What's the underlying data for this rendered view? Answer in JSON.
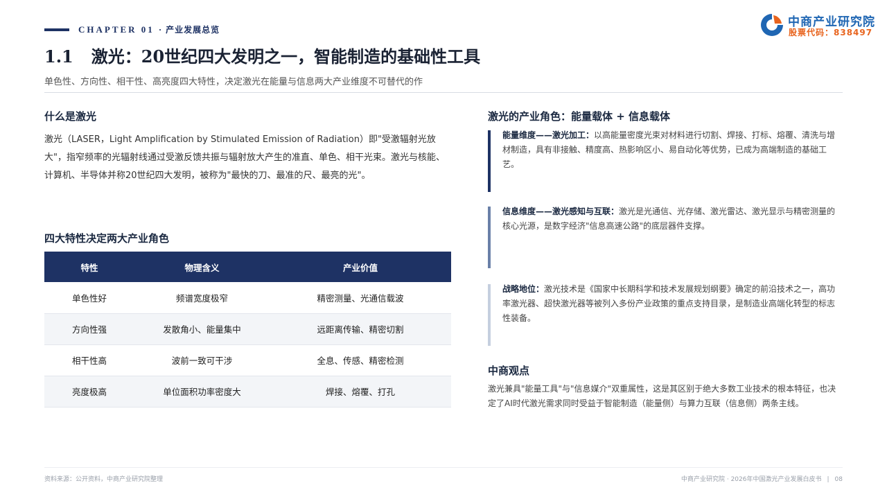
{
  "header": {
    "chapter": "CHAPTER 01",
    "separator": "·",
    "chapter_title": "产业发展总览",
    "logo_name": "中商产业研究院",
    "logo_code": "股票代码：838497",
    "logo_colors": {
      "blue": "#1f66b3",
      "orange": "#e8641e"
    }
  },
  "title": {
    "number": "1.1",
    "text": "激光：20世纪四大发明之一，智能制造的基础性工具"
  },
  "subtitle": "单色性、方向性、相干性、高亮度四大特性，决定激光在能量与信息两大产业维度不可替代的作",
  "left": {
    "what_heading": "什么是激光",
    "what_body": "激光（LASER，Light Amplification by Stimulated Emission of Radiation）即\"受激辐射光放大\"，指窄频率的光辐射线通过受激反馈共振与辐射放大产生的准直、单色、相干光束。激光与核能、计算机、半导体并称20世纪四大发明，被称为\"最快的刀、最准的尺、最亮的光\"。",
    "table_heading": "四大特性决定两大产业角色",
    "table": {
      "headers": [
        "特性",
        "物理含义",
        "产业价值"
      ],
      "rows": [
        [
          "单色性好",
          "频谱宽度极窄",
          "精密测量、光通信载波"
        ],
        [
          "方向性强",
          "发散角小、能量集中",
          "远距离传输、精密切割"
        ],
        [
          "相干性高",
          "波前一致可干涉",
          "全息、传感、精密检测"
        ],
        [
          "亮度极高",
          "单位面积功率密度大",
          "焊接、熔覆、打孔"
        ]
      ]
    }
  },
  "right": {
    "heading": "激光的产业角色：能量载体 + 信息载体",
    "cards": [
      {
        "label": "能量维度——激光加工：",
        "text": "以高能量密度光束对材料进行切割、焊接、打标、熔覆、清洗与增材制造，具有非接触、精度高、热影响区小、易自动化等优势，已成为高端制造的基础工艺。",
        "color": "#1e3264"
      },
      {
        "label": "信息维度——激光感知与互联：",
        "text": "激光是光通信、光存储、激光雷达、激光显示与精密测量的核心光源，是数字经济\"信息高速公路\"的底层器件支撑。",
        "color": "#6a80a8"
      },
      {
        "label": "战略地位：",
        "text": "激光技术是《国家中长期科学和技术发展规划纲要》确定的前沿技术之一，高功率激光器、超快激光器等被列入多份产业政策的重点支持目录，是制造业高端化转型的标志性装备。",
        "color": "#c5cfdf"
      }
    ],
    "opinion_title": "中商观点",
    "opinion_text": "激光兼具\"能量工具\"与\"信息媒介\"双重属性，这是其区别于绝大多数工业技术的根本特征，也决定了AI时代激光需求同时受益于智能制造（能量侧）与算力互联（信息侧）两条主线。"
  },
  "footer": {
    "source": "资料来源：公开资料，中商产业研究院整理",
    "publication": "中商产业研究院 · 2026年中国激光产业发展白皮书",
    "separator": "|",
    "page": "08"
  }
}
